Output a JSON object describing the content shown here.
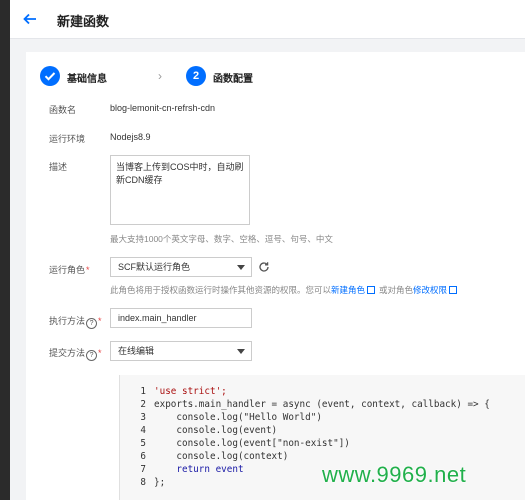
{
  "header": {
    "title": "新建函数"
  },
  "steps": [
    {
      "label": "基础信息",
      "status": "done",
      "icon": "check-icon"
    },
    {
      "label": "函数配置",
      "status": "active",
      "number": "2"
    }
  ],
  "form": {
    "function_name": {
      "label": "函数名",
      "value": "blog-lemonit-cn-refrsh-cdn"
    },
    "runtime": {
      "label": "运行环境",
      "value": "Nodejs8.9"
    },
    "description": {
      "label": "描述",
      "value": "当博客上传到COS中时，自动刷新CDN缓存",
      "hint": "最大支持1000个英文字母、数字、空格、逗号、句号、中文"
    },
    "role": {
      "label": "运行角色",
      "required_mark": "*",
      "value": "SCF默认运行角色",
      "hint_prefix": "此角色将用于授权函数运行时操作其他资源的权限。您可以",
      "link_new": "新建角色",
      "hint_middle": "或对角色",
      "link_edit": "修改权限"
    },
    "handler": {
      "label": "执行方法",
      "help": "?",
      "required_mark": "*",
      "value": "index.main_handler"
    },
    "submit": {
      "label": "提交方法",
      "help": "?",
      "required_mark": "*",
      "value": "在线编辑"
    }
  },
  "code": {
    "lines": [
      "'use strict';",
      "exports.main_handler = async (event, context, callback) => {",
      "    console.log(\"Hello World\")",
      "    console.log(event)",
      "    console.log(event[\"non-exist\"])",
      "    console.log(context)",
      "    return event",
      "};"
    ]
  },
  "watermark": "www.9969.net",
  "colors": {
    "primary": "#006eff",
    "required": "#e54545",
    "watermark": "#21b04b"
  }
}
